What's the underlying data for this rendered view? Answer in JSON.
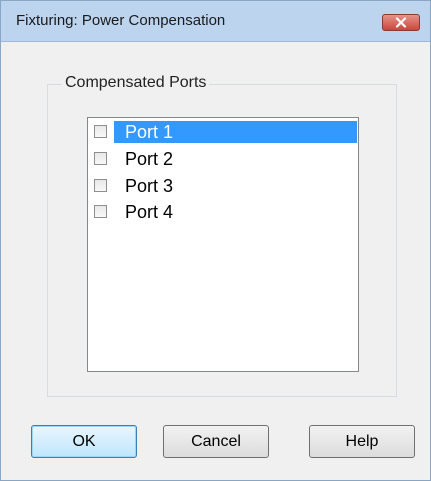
{
  "window": {
    "title": "Fixturing: Power Compensation"
  },
  "group": {
    "label": "Compensated Ports"
  },
  "ports": [
    {
      "label": "Port 1",
      "checked": false,
      "selected": true
    },
    {
      "label": "Port 2",
      "checked": false,
      "selected": false
    },
    {
      "label": "Port 3",
      "checked": false,
      "selected": false
    },
    {
      "label": "Port 4",
      "checked": false,
      "selected": false
    }
  ],
  "buttons": {
    "ok": "OK",
    "cancel": "Cancel",
    "help": "Help"
  },
  "icons": {
    "close": "close-icon"
  },
  "colors": {
    "selection": "#3399ff",
    "titlebar": "#bcd4ee",
    "close": "#c9483d"
  }
}
